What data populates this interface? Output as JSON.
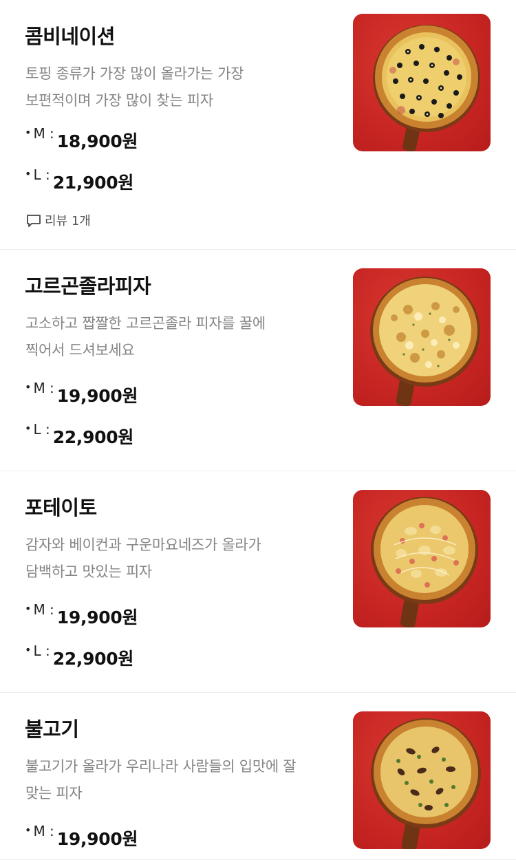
{
  "menu": [
    {
      "name": "콤비네이션",
      "desc": [
        "토핑 종류가 가장 많이 올라가는 가장",
        "보편적이며 가장 많이 찾는 피자"
      ],
      "prices": [
        {
          "size": "M :",
          "amount": "18,900원"
        },
        {
          "size": "L :",
          "amount": "21,900원"
        }
      ],
      "review": "리뷰 1개",
      "image_icon": "pizza-combination-image"
    },
    {
      "name": "고르곤졸라피자",
      "desc": [
        "고소하고 짭짤한 고르곤졸라 피자를 꿀에",
        "찍어서 드셔보세요"
      ],
      "prices": [
        {
          "size": "M :",
          "amount": "19,900원"
        },
        {
          "size": "L :",
          "amount": "22,900원"
        }
      ],
      "image_icon": "pizza-gorgonzola-image"
    },
    {
      "name": "포테이토",
      "desc": [
        "감자와 베이컨과 구운마요네즈가 올라가",
        "담백하고 맛있는 피자"
      ],
      "prices": [
        {
          "size": "M :",
          "amount": "19,900원"
        },
        {
          "size": "L :",
          "amount": "22,900원"
        }
      ],
      "image_icon": "pizza-potato-image"
    },
    {
      "name": "불고기",
      "desc": [
        "불고기가 올라가 우리나라 사람들의 입맛에 잘",
        "맞는 피자"
      ],
      "prices": [
        {
          "size": "M :",
          "amount": "19,900원"
        }
      ],
      "image_icon": "pizza-bulgogi-image"
    }
  ],
  "colors": {
    "image_background": "#c72522",
    "description_text": "#858585",
    "divider": "#ededed"
  }
}
